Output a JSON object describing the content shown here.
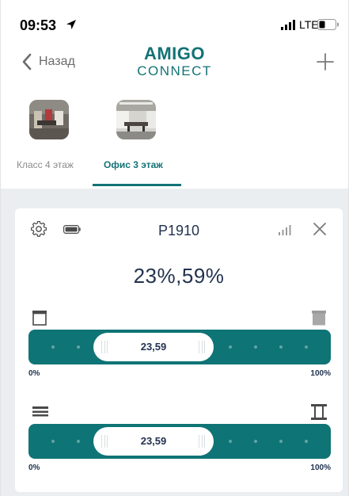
{
  "status_bar": {
    "time": "09:53",
    "network": "LTE"
  },
  "nav": {
    "back_label": "Назад",
    "logo_line1": "AMIGO",
    "logo_line2": "CONNECT"
  },
  "rooms": [
    {
      "label": "Класс 4 этаж",
      "selected": false
    },
    {
      "label": "Офис 3 этаж",
      "selected": true
    }
  ],
  "device": {
    "title": "P1910",
    "percent_text": "23%,59%",
    "sliders": [
      {
        "value_label": "23,59",
        "value_percent": 23.59,
        "min_label": "0%",
        "max_label": "100%",
        "left_icon": "blind-open-icon",
        "right_icon": "blind-closed-icon"
      },
      {
        "value_label": "23,59",
        "value_percent": 23.59,
        "min_label": "0%",
        "max_label": "100%",
        "left_icon": "tilt-closed-icon",
        "right_icon": "tilt-open-icon"
      }
    ]
  },
  "colors": {
    "accent": "#137276",
    "slider": "#0f7475",
    "background": "#ebeef1",
    "title": "#22324f"
  }
}
